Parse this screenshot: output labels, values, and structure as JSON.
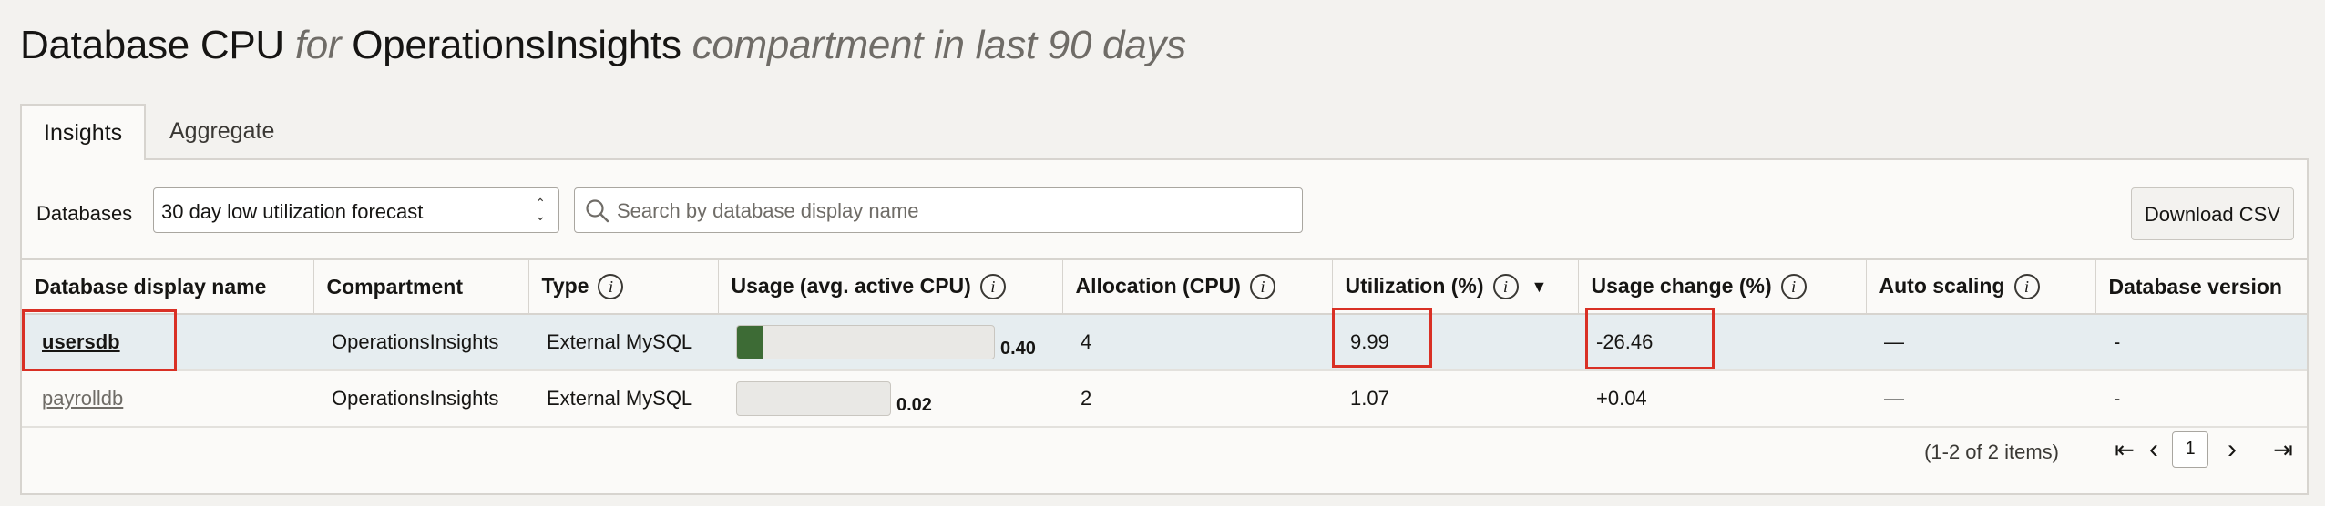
{
  "header": {
    "metric": "Database CPU",
    "for_word": "for",
    "compartment": "OperationsInsights",
    "suffix": "compartment in last 90 days"
  },
  "tabs": [
    {
      "label": "Insights",
      "active": true
    },
    {
      "label": "Aggregate",
      "active": false
    }
  ],
  "toolbar": {
    "databases_label": "Databases",
    "filter_value": "30 day low utilization forecast",
    "search_placeholder": "Search by database display name",
    "download_label": "Download CSV"
  },
  "table": {
    "columns": [
      {
        "label": "Database display name",
        "info": false
      },
      {
        "label": "Compartment",
        "info": false
      },
      {
        "label": "Type",
        "info": true
      },
      {
        "label": "Usage (avg. active CPU)",
        "info": true
      },
      {
        "label": "Allocation (CPU)",
        "info": true
      },
      {
        "label": "Utilization (%)",
        "info": true,
        "sorted": "desc"
      },
      {
        "label": "Usage change (%)",
        "info": true
      },
      {
        "label": "Auto scaling",
        "info": true
      },
      {
        "label": "Database version",
        "info": false
      }
    ],
    "rows": [
      {
        "name": "usersdb",
        "compartment": "OperationsInsights",
        "type": "External MySQL",
        "usage": "0.40",
        "usage_fill_fraction": 0.1,
        "allocation": "4",
        "utilization": "9.99",
        "usage_change": "-26.46",
        "auto_scaling": "—",
        "version": "-"
      },
      {
        "name": "payrolldb",
        "compartment": "OperationsInsights",
        "type": "External MySQL",
        "usage": "0.02",
        "usage_fill_fraction": 0.0,
        "allocation": "2",
        "utilization": "1.07",
        "usage_change": "+0.04",
        "auto_scaling": "—",
        "version": "-"
      }
    ]
  },
  "pagination": {
    "summary": "(1-2 of 2 items)",
    "current_page": "1"
  },
  "colors": {
    "highlight": "#d93025",
    "usage_fill": "#3d6b35",
    "selected_row": "#e6edf0"
  }
}
